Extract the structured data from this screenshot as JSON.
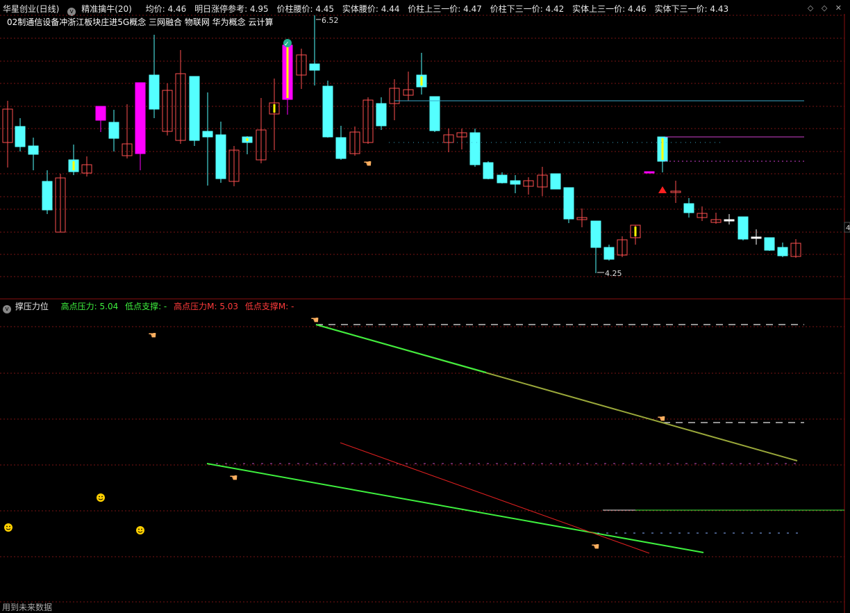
{
  "header": {
    "stock_name": "华星创业(日线)",
    "indicator_name": "精准擒牛(20)",
    "fields": [
      "均价: 4.46",
      "明日涨停参考: 4.95",
      "价柱腰价: 4.45",
      "实体腰价: 4.44",
      "价柱上三一价: 4.47",
      "价柱下三一价: 4.42",
      "实体上三一价: 4.46",
      "实体下三一价: 4.43"
    ],
    "right_controls": "◇ ◇ ✕"
  },
  "concepts": "02制通信设备冲浙江板块庄进5G概念 三网融合 物联网 华为概念 云计算",
  "price_chart": {
    "high_label": "6.52",
    "low_label": "4.25",
    "right_axis_label": "4",
    "colors": {
      "up": "#ff5050",
      "down": "#54ffff",
      "special": "#ff00ff",
      "yellow": "#ffff00"
    }
  },
  "indicator": {
    "name": "撑压力位",
    "fields": [
      {
        "text": "高点压力: 5.04",
        "color": "#3ef03e"
      },
      {
        "text": "低点支撑: -",
        "color": "#3ef03e"
      },
      {
        "text": "高点压力M: 5.03",
        "color": "#ff3b3b"
      },
      {
        "text": "低点支撑M: -",
        "color": "#ff3b3b"
      }
    ]
  },
  "footer": "用到未来数据"
}
